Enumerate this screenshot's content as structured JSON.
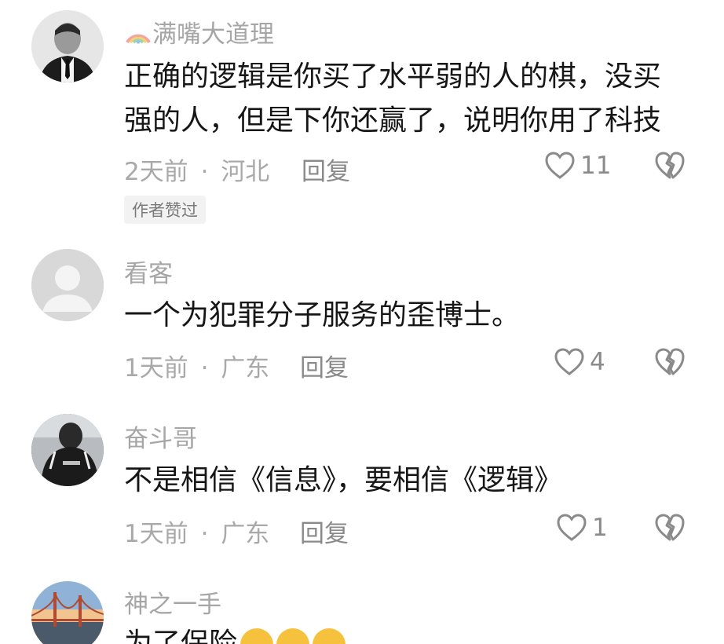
{
  "comments": [
    {
      "username": "满嘴大道理",
      "username_prefix_icon": "rainbow-icon",
      "text_lines": [
        "正确的逻辑是你买了水平弱的人的棋，没买",
        "强的人，但是下你还赢了，说明你用了科技"
      ],
      "time": "2天前",
      "location": "河北",
      "reply_label": "回复",
      "likes": "11",
      "badge": "作者赞过",
      "avatar": "man-in-suit-avatar"
    },
    {
      "username": "看客",
      "text_lines": [
        "一个为犯罪分子服务的歪博士。"
      ],
      "time": "1天前",
      "location": "广东",
      "reply_label": "回复",
      "likes": "4",
      "avatar": "default-avatar"
    },
    {
      "username": "奋斗哥",
      "text_lines": [
        "不是相信《信息》，要相信《逻辑》"
      ],
      "time": "1天前",
      "location": "广东",
      "reply_label": "回复",
      "likes": "1",
      "avatar": "person-in-jacket-avatar"
    },
    {
      "username": "神之一手",
      "text_lines": [
        "为了保险"
      ],
      "emojis": [
        "crying-laughing-emoji",
        "crying-laughing-emoji",
        "crying-laughing-emoji"
      ],
      "avatar": "golden-gate-bridge-avatar"
    }
  ],
  "meta_separator": "·",
  "colors": {
    "text": "#161616",
    "secondary": "#a6a6a6",
    "icon": "#8a8a8a",
    "emoji": "#f6c23e"
  }
}
